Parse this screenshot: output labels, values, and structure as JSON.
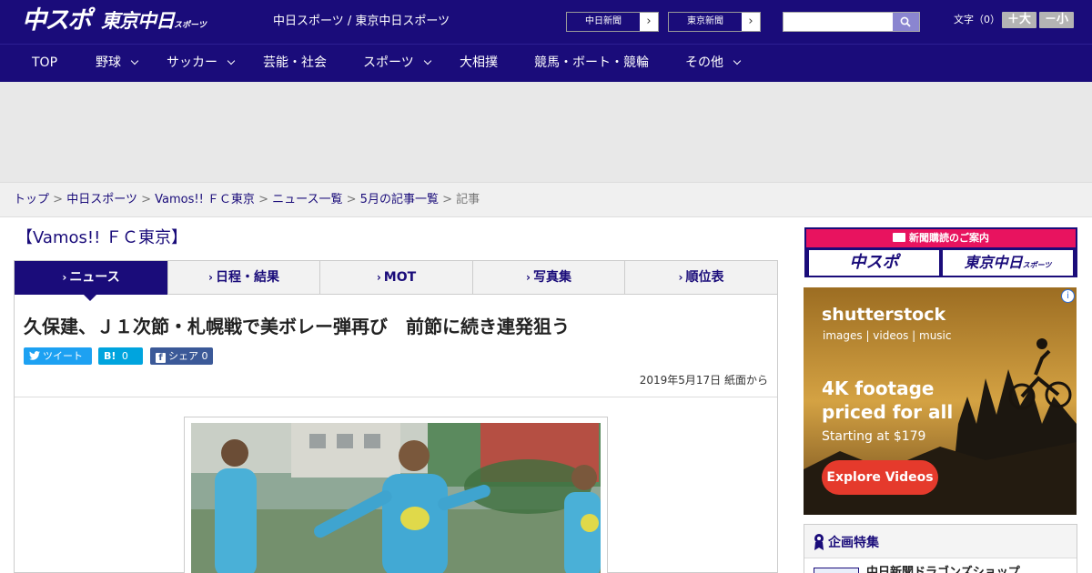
{
  "header": {
    "logo_chunichi_sports": "中スポ",
    "logo_tokyo_chunichi": "東京中日",
    "logo_tokyo_chunichi_small": "スポーツ",
    "site_names": "中日スポーツ / 東京中日スポーツ",
    "paper_buttons": [
      {
        "label": "中日新聞"
      },
      {
        "label": "東京新聞"
      }
    ],
    "search": {
      "value": "",
      "placeholder": ""
    },
    "font_size_label": "文字（0）",
    "font_bigger": "＋大",
    "font_smaller": "－小"
  },
  "nav": {
    "items": [
      {
        "label": "TOP",
        "has_dropdown": false
      },
      {
        "label": "野球",
        "has_dropdown": true
      },
      {
        "label": "サッカー",
        "has_dropdown": true
      },
      {
        "label": "芸能・社会",
        "has_dropdown": false
      },
      {
        "label": "スポーツ",
        "has_dropdown": true
      },
      {
        "label": "大相撲",
        "has_dropdown": false
      },
      {
        "label": "競馬・ボート・競輪",
        "has_dropdown": false
      },
      {
        "label": "その他",
        "has_dropdown": true
      }
    ]
  },
  "breadcrumb": {
    "links": [
      "トップ",
      "中日スポーツ",
      "Vamos!! ＦＣ東京",
      "ニュース一覧",
      "5月の記事一覧"
    ],
    "separator": ">",
    "current": "記事"
  },
  "section": {
    "title": "【Vamos!! ＦＣ東京】",
    "tabs": [
      {
        "label": "ニュース",
        "active": true
      },
      {
        "label": "日程・結果",
        "active": false
      },
      {
        "label": "MOT",
        "active": false
      },
      {
        "label": "写真集",
        "active": false
      },
      {
        "label": "順位表",
        "active": false
      }
    ]
  },
  "article": {
    "headline": "久保建、Ｊ１次節・札幌戦で美ボレー弾再び　前節に続き連発狙う",
    "share": {
      "tweet_label": "ツイート",
      "hatena_icon": "B!",
      "hatena_count": "0",
      "facebook_label": "シェア",
      "facebook_count": "0"
    },
    "date": "2019年5月17日 紙面から"
  },
  "sidebar": {
    "subscribe_header": "新聞購読のご案内",
    "subscribe_logos": [
      "中スポ",
      "東京中日"
    ],
    "subscribe_logo_small": "スポーツ",
    "ad": {
      "brand": "shutterstock",
      "sub": "images  |  videos  |  music",
      "headline1": "4K footage",
      "headline2": "priced for all",
      "price": "Starting at $179",
      "cta": "Explore Videos",
      "info_icon": "i"
    },
    "features": {
      "title": "企画特集",
      "first_item": "中日新聞ドラゴンズショップ"
    }
  },
  "colors": {
    "brand_navy": "#1a0c7a",
    "accent_pink": "#e8135f",
    "twitter": "#1da1f2",
    "hatena": "#00a4de",
    "facebook": "#3b5998",
    "ad_cta": "#e53a2c"
  }
}
